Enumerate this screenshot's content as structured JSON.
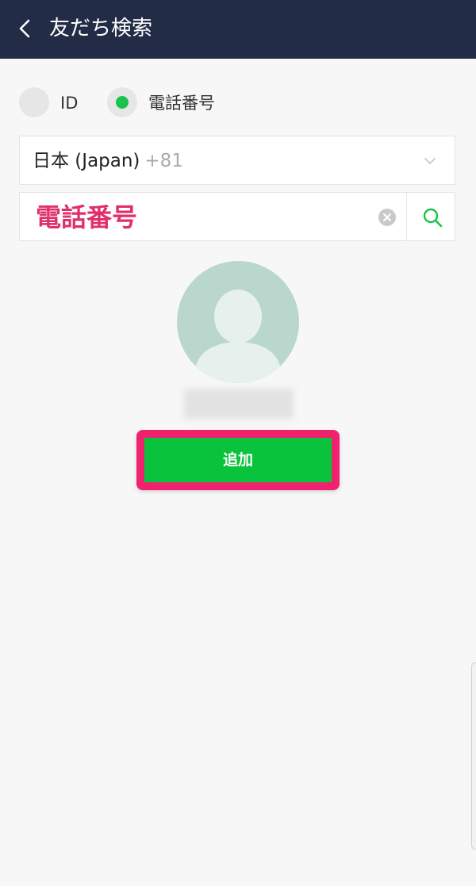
{
  "header": {
    "title": "友だち検索",
    "back_icon": "chevron-left-icon"
  },
  "search_type": {
    "options": [
      {
        "label": "ID",
        "selected": false
      },
      {
        "label": "電話番号",
        "selected": true
      }
    ]
  },
  "country": {
    "name": "日本 (Japan)",
    "code": "+81"
  },
  "phone": {
    "placeholder": "電話番号",
    "clear_icon": "clear-icon",
    "search_icon": "search-icon"
  },
  "result": {
    "avatar_icon": "default-avatar-icon",
    "add_label": "追加"
  },
  "colors": {
    "header_bg": "#232c47",
    "accent_green": "#09c33c",
    "highlight_pink": "#f0226f"
  }
}
